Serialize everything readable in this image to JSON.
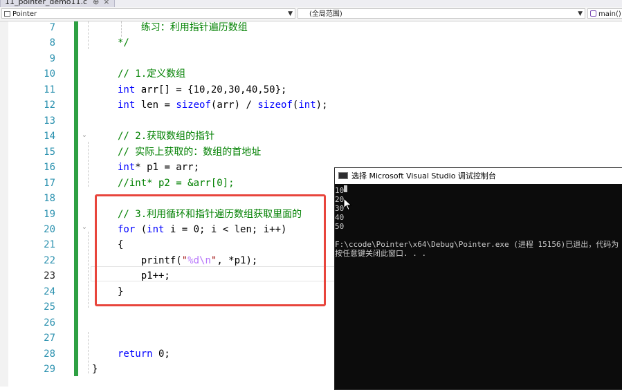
{
  "tab": {
    "label": "11_pointer_demo11.c",
    "pin_glyph": "⊕",
    "close_glyph": "×"
  },
  "navbar": {
    "project": "Pointer",
    "scope": "(全局范围)",
    "member": "main()"
  },
  "editor": {
    "current_line": 23,
    "lines": [
      {
        "no": "7",
        "code": "    练习：利用指针遍历数组"
      },
      {
        "no": "8",
        "code": "*/"
      },
      {
        "no": "9",
        "code": ""
      },
      {
        "no": "10",
        "code": "// 1.定义数组"
      },
      {
        "no": "11",
        "code": "int arr[] = {10,20,30,40,50};"
      },
      {
        "no": "12",
        "code": "int len = sizeof(arr) / sizeof(int);"
      },
      {
        "no": "13",
        "code": ""
      },
      {
        "no": "14",
        "code": "// 2.获取数组的指针"
      },
      {
        "no": "15",
        "code": "// 实际上获取的：数组的首地址"
      },
      {
        "no": "16",
        "code": "int* p1 = arr;"
      },
      {
        "no": "17",
        "code": "//int* p2 = &arr[0];"
      },
      {
        "no": "18",
        "code": ""
      },
      {
        "no": "19",
        "code": "// 3.利用循环和指针遍历数组获取里面的"
      },
      {
        "no": "20",
        "code": "for (int i = 0; i < len; i++)"
      },
      {
        "no": "21",
        "code": "{"
      },
      {
        "no": "22",
        "code": "    printf(\"%d\\n\", *p1);"
      },
      {
        "no": "23",
        "code": "    p1++;"
      },
      {
        "no": "24",
        "code": "}"
      },
      {
        "no": "25",
        "code": ""
      },
      {
        "no": "26",
        "code": ""
      },
      {
        "no": "27",
        "code": ""
      },
      {
        "no": "28",
        "code": "return 0;"
      },
      {
        "no": "29",
        "code": "}"
      }
    ]
  },
  "console": {
    "title": "选择 Microsoft Visual Studio 调试控制台",
    "output": [
      "10",
      "20",
      "30",
      "40",
      "50",
      "",
      "F:\\ccode\\Pointer\\x64\\Debug\\Pointer.exe (进程 15156)已退出，代码为",
      "按任意键关闭此窗口. . ."
    ]
  },
  "colors": {
    "comment": "#008000",
    "keyword": "#0000ff",
    "string": "#a31515",
    "escape": "#b776fb",
    "line_number": "#2b91af",
    "change_bar": "#2ea043",
    "highlight_box": "#e8453c",
    "console_bg": "#0c0c0c",
    "console_text": "#cccccc"
  }
}
